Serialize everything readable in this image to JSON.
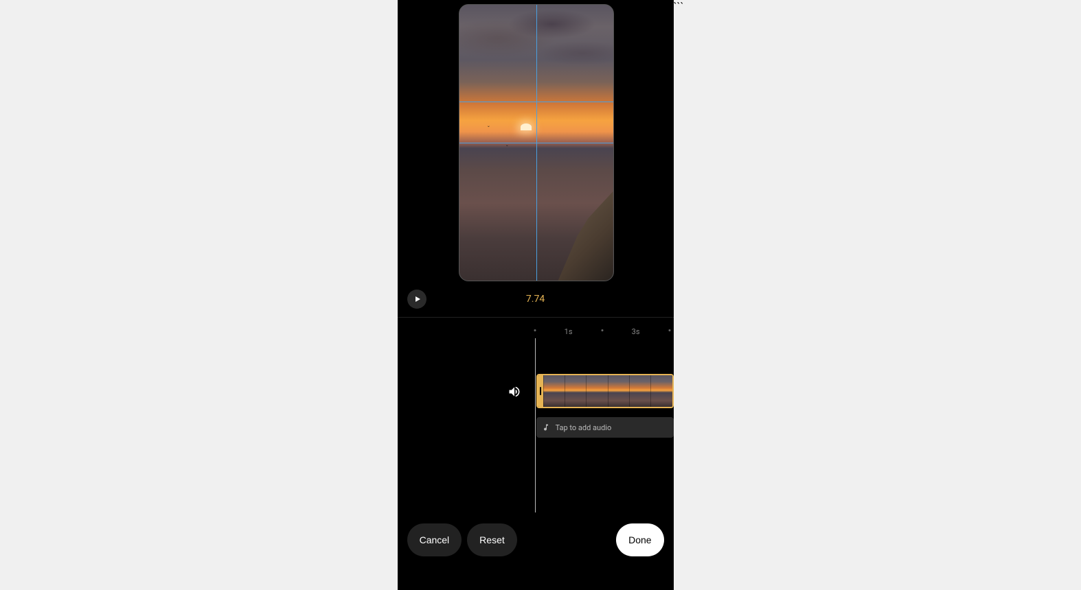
{
  "preview": {
    "duration_label": "7.74",
    "accent_color": "#e6b454",
    "guide_color": "#4aa0e0"
  },
  "timeline": {
    "ticks": [
      "1s",
      "3s"
    ],
    "audio_prompt": "Tap to add audio",
    "thumb_count": 6
  },
  "buttons": {
    "cancel": "Cancel",
    "reset": "Reset",
    "done": "Done"
  },
  "icons": {
    "play": "play-icon",
    "sound": "sound-icon",
    "music": "music-note-icon"
  }
}
